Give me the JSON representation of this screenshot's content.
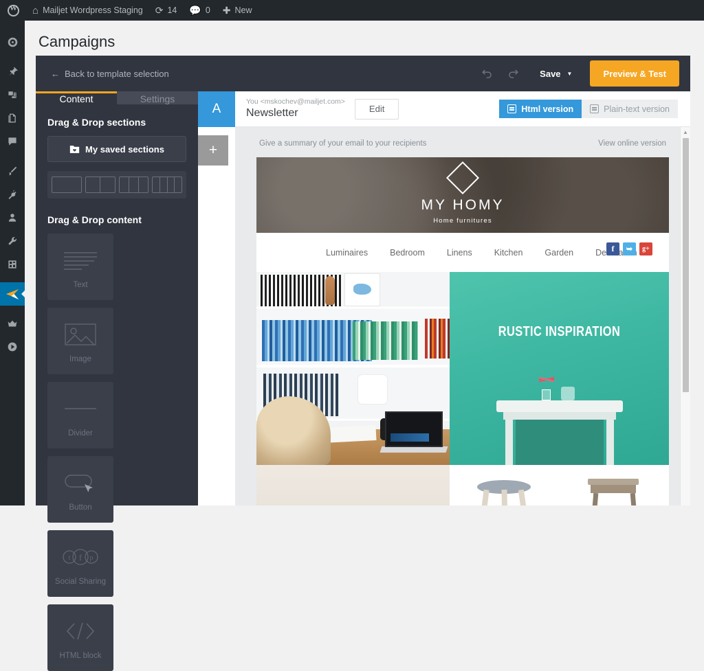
{
  "adminbar": {
    "logo_icon": "wordpress-logo-icon",
    "home_icon": "home-icon",
    "site_name": "Mailjet Wordpress Staging",
    "updates_icon": "updates-icon",
    "updates_count": "14",
    "comments_icon": "comment-bubble-icon",
    "comments_count": "0",
    "new_icon": "plus-icon",
    "new_label": "New"
  },
  "adminmenu": {
    "items": [
      {
        "name": "dashboard-icon",
        "active": false
      },
      {
        "name": "posts-pin-icon",
        "active": false
      },
      {
        "name": "media-icon",
        "active": false
      },
      {
        "name": "pages-icon",
        "active": false
      },
      {
        "name": "comments-icon",
        "active": false
      },
      {
        "name": "appearance-brush-icon",
        "active": false
      },
      {
        "name": "plugins-plug-icon",
        "active": false
      },
      {
        "name": "users-icon",
        "active": false
      },
      {
        "name": "tools-wrench-icon",
        "active": false
      },
      {
        "name": "settings-icon",
        "active": false
      },
      {
        "name": "mailjet-plane-icon",
        "active": true
      },
      {
        "name": "crown-icon",
        "active": false
      },
      {
        "name": "play-circle-icon",
        "active": false
      }
    ]
  },
  "page": {
    "title": "Campaigns"
  },
  "toolbar": {
    "back_label": "Back to template selection",
    "back_arrow": "←",
    "undo_icon": "undo-icon",
    "redo_icon": "redo-icon",
    "save_label": "Save",
    "save_caret": "▼",
    "preview_label": "Preview & Test",
    "accent_orange": "#f5a623",
    "background": "#31353f"
  },
  "left_panel": {
    "tabs": [
      {
        "label": "Content",
        "active": true
      },
      {
        "label": "Settings",
        "active": false
      }
    ],
    "sections_heading": "Drag & Drop sections",
    "saved_sections_label": "My saved sections",
    "saved_sections_icon": "folder-heart-icon",
    "layouts": [
      {
        "name": "layout-1-column",
        "cols": 1
      },
      {
        "name": "layout-2-columns",
        "cols": 2
      },
      {
        "name": "layout-3-columns",
        "cols": 3
      },
      {
        "name": "layout-4-columns",
        "cols": 4
      }
    ],
    "content_heading": "Drag & Drop content",
    "content_tiles": [
      {
        "label": "Text",
        "icon": "text-lines-icon"
      },
      {
        "label": "Image",
        "icon": "image-icon"
      },
      {
        "label": "Divider",
        "icon": "divider-line-icon"
      },
      {
        "label": "Button",
        "icon": "button-cursor-icon"
      },
      {
        "label": "Social Sharing",
        "icon": "social-sharing-icon"
      },
      {
        "label": "HTML block",
        "icon": "html-code-icon"
      }
    ]
  },
  "rail": {
    "styles_label": "A",
    "styles_icon": "text-styles-icon",
    "add_label": "+",
    "add_icon": "plus-icon",
    "styles_color": "#3498db"
  },
  "mail_head": {
    "from": "You <mskochev@mailjet.com>",
    "subject": "Newsletter",
    "edit_label": "Edit",
    "html_version_label": "Html version",
    "plain_version_label": "Plain-text version"
  },
  "email": {
    "preheader": "Give a summary of your email to your recipients",
    "view_online": "View online version",
    "brand": "MY HOMY",
    "tagline": "Home furnitures",
    "logo_icon": "diamond-logo-icon",
    "nav": [
      "Luminaires",
      "Bedroom",
      "Linens",
      "Kitchen",
      "Garden",
      "Decoration"
    ],
    "social": [
      {
        "name": "facebook-icon",
        "glyph": "f",
        "color": "#3b5998"
      },
      {
        "name": "twitter-icon",
        "glyph": "t",
        "color": "#4fb0e8"
      },
      {
        "name": "google-plus-icon",
        "glyph": "g+",
        "color": "#d9453b"
      }
    ],
    "banner_title": "RUSTIC INSPIRATION",
    "collage_alt": "bookshelf-and-desk-photo",
    "products": [
      {
        "name": "product-stool"
      },
      {
        "name": "product-side-table"
      }
    ]
  },
  "scrollbar": {
    "up_arrow": "▲"
  }
}
